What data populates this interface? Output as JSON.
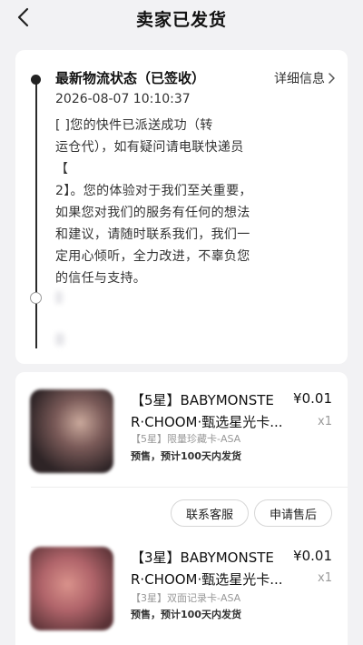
{
  "header": {
    "title": "卖家已发货",
    "back_icon": "chevron-left-icon"
  },
  "logistics": {
    "status_title": "最新物流状态（已签收）",
    "detail_label": "详细信息",
    "timestamp": "2026-08-07 10:10:37",
    "message_lines": [
      "[ ]您的快件已派送成功（转",
      "运仓代），如有疑问请电联快递员",
      "【",
      "2】。您的体验对于我们至关重要，",
      "如果您对我们的服务有任何的想法",
      "和建议，请随时联系我们，我们一",
      "定用心倾听，全力改进，不辜负您",
      "的信任与支持。"
    ]
  },
  "order": {
    "items": [
      {
        "title_line1": "【5星】BABYMONSTE",
        "title_line2": "R·CHOOM·甄选星光卡...",
        "price": "¥0.01",
        "qty": "x1",
        "spec": "【5星】限量珍藏卡-ASA",
        "presale": "预售，预计100天内发货"
      },
      {
        "title_line1": "【3星】BABYMONSTE",
        "title_line2": "R·CHOOM·甄选星光卡...",
        "price": "¥0.01",
        "qty": "x1",
        "spec": "【3星】双面记录卡-ASA",
        "presale": "预售，预计100天内发货"
      }
    ],
    "buttons": {
      "contact": "联系客服",
      "after_sale": "申请售后"
    }
  }
}
